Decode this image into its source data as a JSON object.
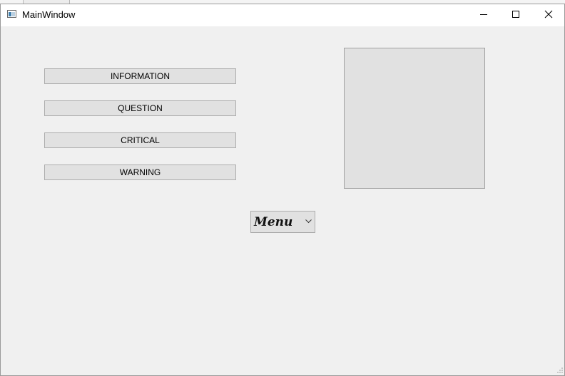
{
  "window": {
    "title": "MainWindow",
    "icon": "app-window-icon"
  },
  "titlebar_controls": {
    "minimize_icon": "minimize-icon",
    "maximize_icon": "maximize-icon",
    "close_icon": "close-icon"
  },
  "buttons": {
    "information": "INFORMATION",
    "question": "QUESTION",
    "critical": "CRITICAL",
    "warning": "WARNING"
  },
  "combo": {
    "selected": "Menu",
    "arrow_icon": "chevron-down-icon"
  },
  "colors": {
    "window_bg": "#f0f0f0",
    "button_bg": "#e1e1e1",
    "button_border": "#adadad",
    "titlebar_bg": "#ffffff"
  }
}
